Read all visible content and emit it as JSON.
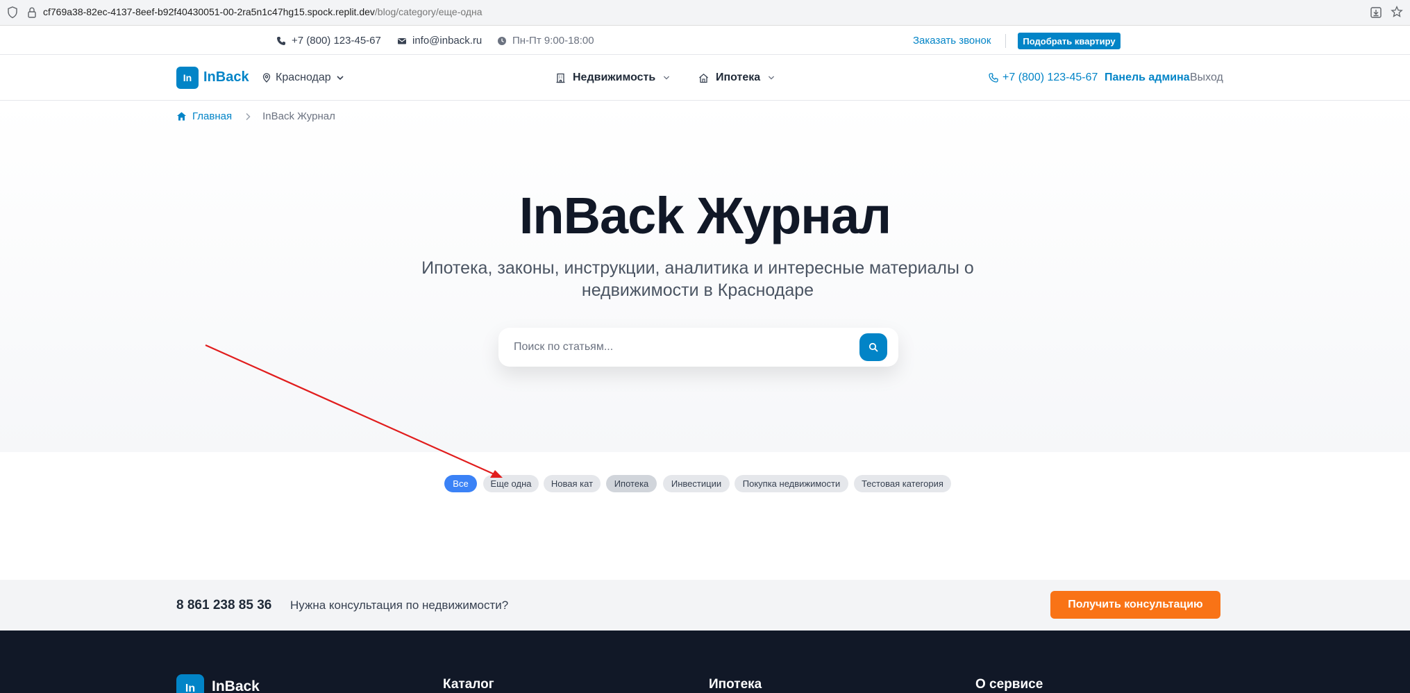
{
  "browser": {
    "url_host": "cf769a38-82ec-4137-8eef-b92f40430051-00-2ra5n1c47hg15.spock.replit.dev",
    "url_path": "/blog/category/еще-одна"
  },
  "topbar": {
    "phone": "+7 (800) 123-45-67",
    "email": "info@inback.ru",
    "hours": "Пн-Пт 9:00-18:00",
    "callback_label": "Заказать звонок",
    "pick_label": "Подобрать квартиру"
  },
  "header": {
    "logo_mark": "In",
    "logo_name": "InBack",
    "city": "Краснодар",
    "nav": [
      {
        "label": "Недвижимость"
      },
      {
        "label": "Ипотека"
      }
    ],
    "phone": "+7 (800) 123-45-67",
    "admin_label": "Панель админа",
    "logout_label": "Выход"
  },
  "breadcrumb": {
    "home": "Главная",
    "current": "InBack Журнал"
  },
  "hero": {
    "title": "InBack Журнал",
    "subtitle": "Ипотека, законы, инструкции, аналитика и интересные материалы о недвижимости в Краснодаре",
    "search_placeholder": "Поиск по статьям..."
  },
  "categories": [
    {
      "label": "Все",
      "state": "active"
    },
    {
      "label": "Еще одна",
      "state": "normal"
    },
    {
      "label": "Новая кат",
      "state": "normal"
    },
    {
      "label": "Ипотека",
      "state": "hover"
    },
    {
      "label": "Инвестиции",
      "state": "normal"
    },
    {
      "label": "Покупка недвижимости",
      "state": "normal"
    },
    {
      "label": "Тестовая категория",
      "state": "normal"
    }
  ],
  "cta": {
    "phone": "8 861 238 85 36",
    "question": "Нужна консультация по недвижимости?",
    "button_label": "Получить консультацию"
  },
  "footer": {
    "logo_mark": "In",
    "logo_name": "InBack",
    "columns": [
      "Каталог",
      "Ипотека",
      "О сервисе"
    ]
  },
  "colors": {
    "accent": "#0284c7",
    "chip_active": "#3b82f6",
    "cta_orange": "#f97316",
    "footer_bg": "#111827",
    "annotation_red": "#e11d1d"
  }
}
